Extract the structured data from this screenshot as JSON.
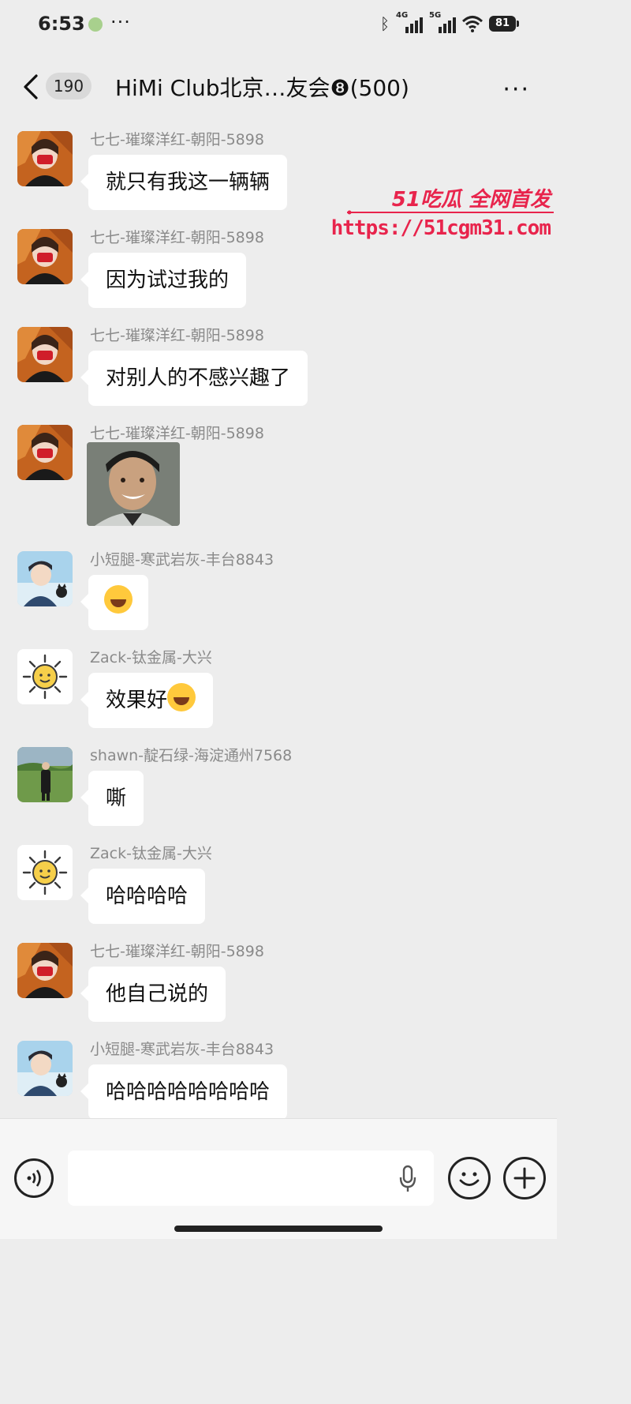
{
  "status_bar": {
    "time": "6:53",
    "dots": "···",
    "network_1": "4G",
    "network_2": "5G",
    "battery": "81"
  },
  "header": {
    "unread_count": "190",
    "title": "HiMi Club北京…友会❽(500)"
  },
  "watermark": {
    "brand": "51吃瓜 全网首发",
    "url": "https://51cgm31.com"
  },
  "messages": [
    {
      "sender": "七七-璀璨洋红-朝阳-5898",
      "text": "就只有我这一辆辆",
      "avatar": "girl-red-mask"
    },
    {
      "sender": "七七-璀璨洋红-朝阳-5898",
      "text": "因为试过我的",
      "avatar": "girl-red-mask"
    },
    {
      "sender": "七七-璀璨洋红-朝阳-5898",
      "text": "对别人的不感兴趣了",
      "avatar": "girl-red-mask"
    },
    {
      "sender": "七七-璀璨洋红-朝阳-5898",
      "sticker": "smiling-man-photo",
      "avatar": "girl-red-mask"
    },
    {
      "sender": "小短腿-寒武岩灰-丰台8843",
      "emoji": "rolling-laughing-emoji",
      "avatar": "anime-boy-cat"
    },
    {
      "sender": "Zack-钛金属-大兴",
      "text": "效果好",
      "emoji": "tears-of-joy-emoji",
      "avatar": "sun-doodle"
    },
    {
      "sender": "shawn-靛石绿-海淀通州7568",
      "text": "嘶",
      "avatar": "man-on-grass"
    },
    {
      "sender": "Zack-钛金属-大兴",
      "text": "哈哈哈哈",
      "avatar": "sun-doodle"
    },
    {
      "sender": "七七-璀璨洋红-朝阳-5898",
      "text": "他自己说的",
      "avatar": "girl-red-mask"
    },
    {
      "sender": "小短腿-寒武岩灰-丰台8843",
      "text": "哈哈哈哈哈哈哈哈",
      "avatar": "anime-boy-cat"
    }
  ],
  "input_bar": {
    "placeholder": ""
  }
}
